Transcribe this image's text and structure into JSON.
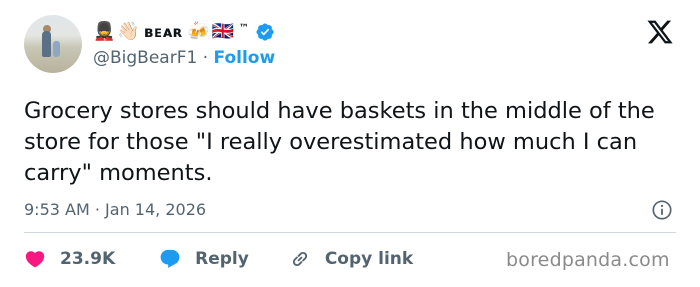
{
  "author": {
    "display_name": "ʙᴇᴀʀ",
    "name_emojis_before": [
      "💂",
      "👋🏻"
    ],
    "name_emojis_after": [
      "🍻",
      "🇬🇧"
    ],
    "tm": "™",
    "handle": "@BigBearF1",
    "separator": "·",
    "follow_label": "Follow"
  },
  "tweet": {
    "text": "Grocery stores should have baskets in the middle of the store for those \"I really overestimated how much I can carry\" moments.",
    "time": "9:53 AM",
    "date_separator": "·",
    "date": "Jan 14, 2026"
  },
  "actions": {
    "likes": "23.9K",
    "reply_label": "Reply",
    "copy_link_label": "Copy link"
  },
  "watermark": "boredpanda.com",
  "colors": {
    "accent": "#1d9bf0",
    "like": "#f91880",
    "text": "#0f1419",
    "secondary": "#536471",
    "divider": "#cfd9de"
  },
  "icons": [
    "verified-badge-icon",
    "x-logo-icon",
    "info-icon",
    "heart-icon",
    "reply-bubble-icon",
    "link-icon"
  ]
}
